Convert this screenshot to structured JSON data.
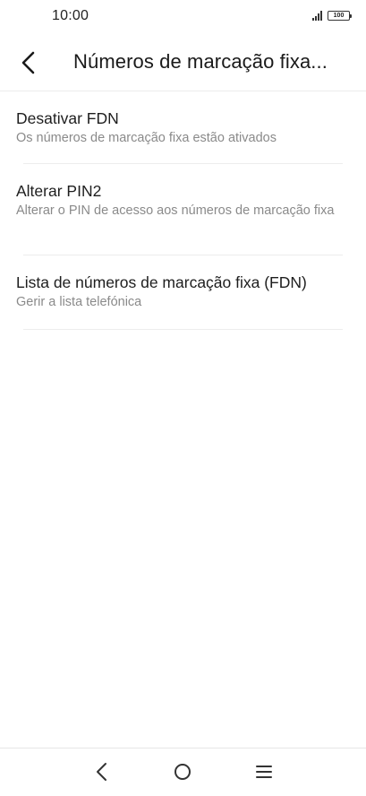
{
  "status_bar": {
    "time": "10:00",
    "battery_level": "100",
    "icons": [
      "signal-icon",
      "battery-icon"
    ]
  },
  "header": {
    "title": "Números de marcação fixa...",
    "back_icon": "chevron-left-icon"
  },
  "settings": {
    "items": [
      {
        "title": "Desativar FDN",
        "subtitle": "Os números de marcação fixa estão ativados"
      },
      {
        "title": "Alterar PIN2",
        "subtitle": "Alterar o PIN de acesso aos números de marcação fixa"
      },
      {
        "title": "Lista de números de marcação fixa (FDN)",
        "subtitle": "Gerir a lista telefónica"
      }
    ]
  },
  "navigation_bar": {
    "icons": [
      "back-icon",
      "home-icon",
      "menu-icon"
    ]
  },
  "colors": {
    "background": "#ffffff",
    "title_text": "#1e1e1e",
    "subtitle_text": "#8a8a8a",
    "divider": "#ededed"
  }
}
